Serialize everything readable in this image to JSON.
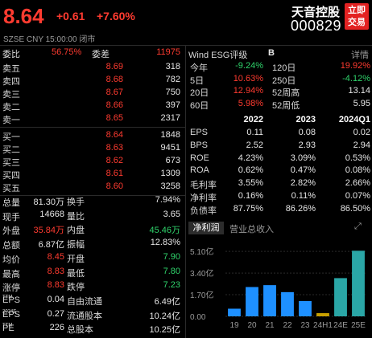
{
  "header": {
    "price": "8.64",
    "change": "+0.61",
    "change_pct": "+7.60%",
    "exchange": "SZSE",
    "currency": "CNY",
    "time": "15:00:00",
    "status": "闭市",
    "name": "天音控股",
    "code": "000829",
    "trade_button": "立即交易"
  },
  "orderbook": {
    "ratio": {
      "label": "委比",
      "value": "56.75%",
      "diff_label": "委差",
      "diff_value": "11975"
    },
    "asks": [
      {
        "label": "卖五",
        "price": "8.69",
        "volume": "318"
      },
      {
        "label": "卖四",
        "price": "8.68",
        "volume": "782"
      },
      {
        "label": "卖三",
        "price": "8.67",
        "volume": "750"
      },
      {
        "label": "卖二",
        "price": "8.66",
        "volume": "397"
      },
      {
        "label": "卖一",
        "price": "8.65",
        "volume": "2317"
      }
    ],
    "bids": [
      {
        "label": "买一",
        "price": "8.64",
        "volume": "1848"
      },
      {
        "label": "买二",
        "price": "8.63",
        "volume": "9451"
      },
      {
        "label": "买三",
        "price": "8.62",
        "volume": "673"
      },
      {
        "label": "买四",
        "price": "8.61",
        "volume": "1309"
      },
      {
        "label": "买五",
        "price": "8.60",
        "volume": "3258"
      }
    ]
  },
  "stats": [
    {
      "k1": "总量",
      "v1": "81.30万",
      "k2": "换手",
      "v2": "7.94%"
    },
    {
      "k1": "现手",
      "v1": "14668",
      "k2": "量比",
      "v2": "3.65"
    },
    {
      "k1": "外盘",
      "v1": "35.84万",
      "k2": "内盘",
      "v2": "45.46万"
    },
    {
      "k1": "总额",
      "v1": "6.87亿",
      "k2": "振幅",
      "v2": "12.83%"
    },
    {
      "k1": "均价",
      "v1": "8.45",
      "k2": "开盘",
      "v2": "7.90"
    },
    {
      "k1": "最高",
      "v1": "8.83",
      "k2": "最低",
      "v2": "7.80"
    },
    {
      "k1": "涨停",
      "v1": "8.83",
      "k2": "跌停",
      "v2": "7.23"
    },
    {
      "k1": "EPS",
      "k1sup": "TTM",
      "v1": "0.04",
      "k2": "自由流通",
      "v2": "6.49亿"
    },
    {
      "k1": "EPS",
      "k1sup": "2024E",
      "v1": "0.27",
      "k2": "流通股本",
      "v2": "10.24亿"
    },
    {
      "k1": "PE",
      "k1sup": "TTM",
      "v1": "226",
      "k2": "总股本",
      "v2": "10.25亿"
    }
  ],
  "esg": {
    "label": "Wind ESG评级",
    "grade": "B",
    "detail": "详情"
  },
  "performance": [
    {
      "k": "今年",
      "v": "-9.24%",
      "k2": "120日",
      "v2": "19.92%"
    },
    {
      "k": "5日",
      "v": "10.63%",
      "k2": "250日",
      "v2": "-4.12%"
    },
    {
      "k": "20日",
      "v": "12.94%",
      "k2": "52周高",
      "v2": "13.14"
    },
    {
      "k": "60日",
      "v": "5.98%",
      "k2": "52周低",
      "v2": "5.95"
    }
  ],
  "financials": {
    "headers": [
      "2022",
      "2023",
      "2024Q1"
    ],
    "rows": [
      {
        "k": "EPS",
        "vals": [
          "0.11",
          "0.08",
          "0.02"
        ]
      },
      {
        "k": "BPS",
        "vals": [
          "2.52",
          "2.93",
          "2.94"
        ]
      },
      {
        "k": "ROE",
        "vals": [
          "4.23%",
          "3.09%",
          "0.53%"
        ]
      },
      {
        "k": "ROA",
        "vals": [
          "0.62%",
          "0.47%",
          "0.08%"
        ]
      },
      {
        "k": "毛利率",
        "vals": [
          "3.55%",
          "2.82%",
          "2.66%"
        ]
      },
      {
        "k": "净利率",
        "vals": [
          "0.16%",
          "0.11%",
          "0.07%"
        ]
      },
      {
        "k": "负债率",
        "vals": [
          "87.75%",
          "86.26%",
          "86.50%"
        ]
      }
    ]
  },
  "chart_tabs": {
    "active": "净利润",
    "other": "营业总收入"
  },
  "chart_data": {
    "type": "bar",
    "categories": [
      "19",
      "20",
      "21",
      "22",
      "23",
      "24H1",
      "24E",
      "25E"
    ],
    "values": [
      0.6,
      2.3,
      2.45,
      1.9,
      1.2,
      0.25,
      3.0,
      5.15
    ],
    "colors": [
      "#1e90ff",
      "#1e90ff",
      "#1e90ff",
      "#1e90ff",
      "#1e90ff",
      "#c8a000",
      "#2aa6a6",
      "#2aa6a6"
    ],
    "ytick_labels": [
      "5.10亿",
      "3.40亿",
      "1.70亿",
      "0.00"
    ],
    "ylim": [
      0,
      5.8
    ]
  }
}
